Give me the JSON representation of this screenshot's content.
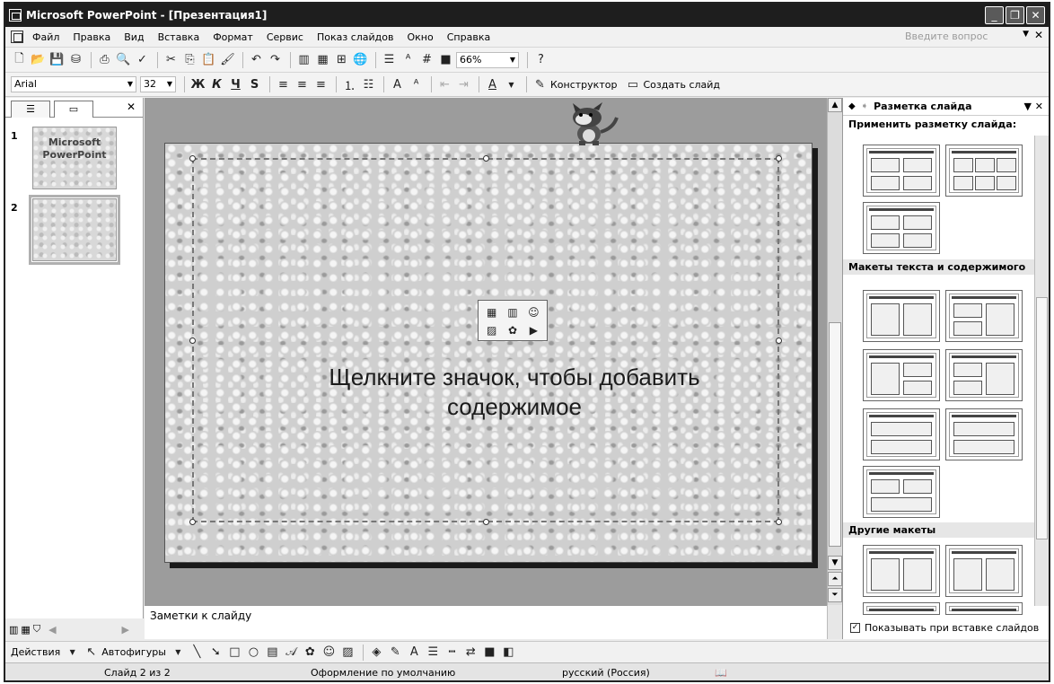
{
  "window": {
    "title": "Microsoft PowerPoint - [Презентация1]",
    "controls": [
      "_",
      "❐",
      "✕"
    ]
  },
  "menubar": {
    "items": [
      "Файл",
      "Правка",
      "Вид",
      "Вставка",
      "Формат",
      "Сервис",
      "Показ слайдов",
      "Окно",
      "Справка"
    ],
    "help_placeholder": "Введите вопрос"
  },
  "standard_toolbar": {
    "zoom": "66%"
  },
  "format_toolbar": {
    "font": "Arial",
    "size": "32",
    "bold": "Ж",
    "italic": "К",
    "underline": "Ч",
    "shadow": "S",
    "designer": "Конструктор",
    "new_slide": "Создать слайд"
  },
  "slides_pane": {
    "close": "✕",
    "slides": [
      {
        "number": "1",
        "text_line1": "Microsoft",
        "text_line2": "PowerPoint"
      },
      {
        "number": "2",
        "text_line1": "",
        "text_line2": ""
      }
    ]
  },
  "slide": {
    "placeholder_text_line1": "Щелкните значок, чтобы добавить",
    "placeholder_text_line2": "содержимое"
  },
  "task_pane": {
    "title": "Разметка слайда",
    "apply_label": "Применить разметку слайда:",
    "section_text_content": "Макеты текста и содержимого",
    "section_other": "Другие макеты",
    "show_on_insert": "Показывать при вставке слайдов",
    "show_on_insert_checked": true
  },
  "notes": {
    "placeholder": "Заметки к слайду"
  },
  "drawing_toolbar": {
    "actions": "Действия",
    "autoshapes": "Автофигуры"
  },
  "statusbar": {
    "slide": "Слайд 2 из 2",
    "design": "Оформление по умолчанию",
    "language": "русский (Россия)"
  }
}
